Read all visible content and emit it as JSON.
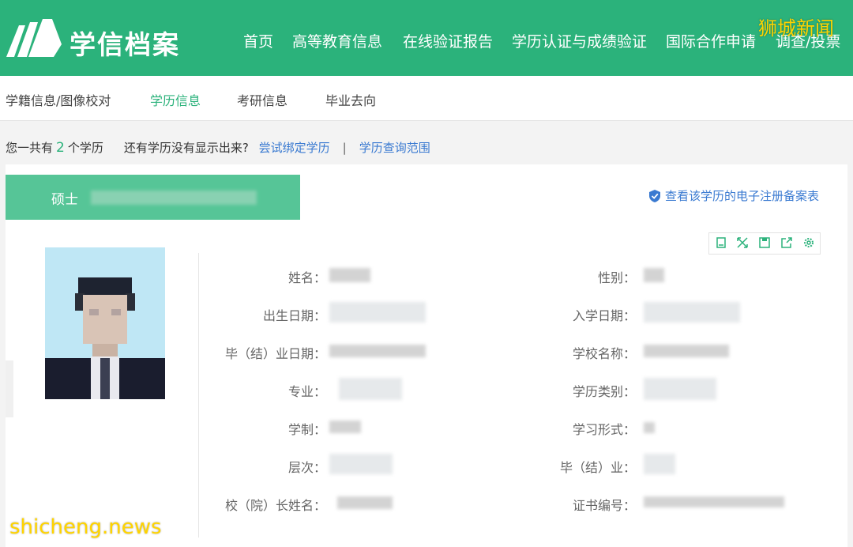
{
  "header": {
    "brand": "学信档案",
    "nav": [
      "首页",
      "高等教育信息",
      "在线验证报告",
      "学历认证与成绩验证",
      "国际合作申请",
      "调查/投票"
    ]
  },
  "watermarks": {
    "top": "狮城新闻",
    "bottom": "shicheng.news"
  },
  "subnav": {
    "items": [
      "学籍信息/图像校对",
      "学历信息",
      "考研信息",
      "毕业去向"
    ],
    "active_index": 1
  },
  "summary": {
    "prefix": "您一共有",
    "count": "2",
    "suffix": "个学历",
    "question": "还有学历没有显示出来?",
    "bind_link": "尝试绑定学历",
    "separator": "|",
    "scope_link": "学历查询范围"
  },
  "record": {
    "degree": "硕士",
    "registration_link": "查看该学历的电子注册备案表",
    "toolbar_icons": [
      "document-icon",
      "fullscreen-icon",
      "save-icon",
      "export-icon",
      "settings-icon"
    ],
    "left_fields": [
      "姓名：",
      "出生日期：",
      "毕（结）业日期：",
      "专业：",
      "学制：",
      "层次：",
      "校（院）长姓名："
    ],
    "right_fields": [
      "性别：",
      "入学日期：",
      "学校名称：",
      "学历类别：",
      "学习形式：",
      "毕（结）业：",
      "证书编号："
    ]
  },
  "colors": {
    "brand_green": "#2bb27b",
    "tab_green": "#56c597",
    "link_blue": "#3a7ad1"
  }
}
